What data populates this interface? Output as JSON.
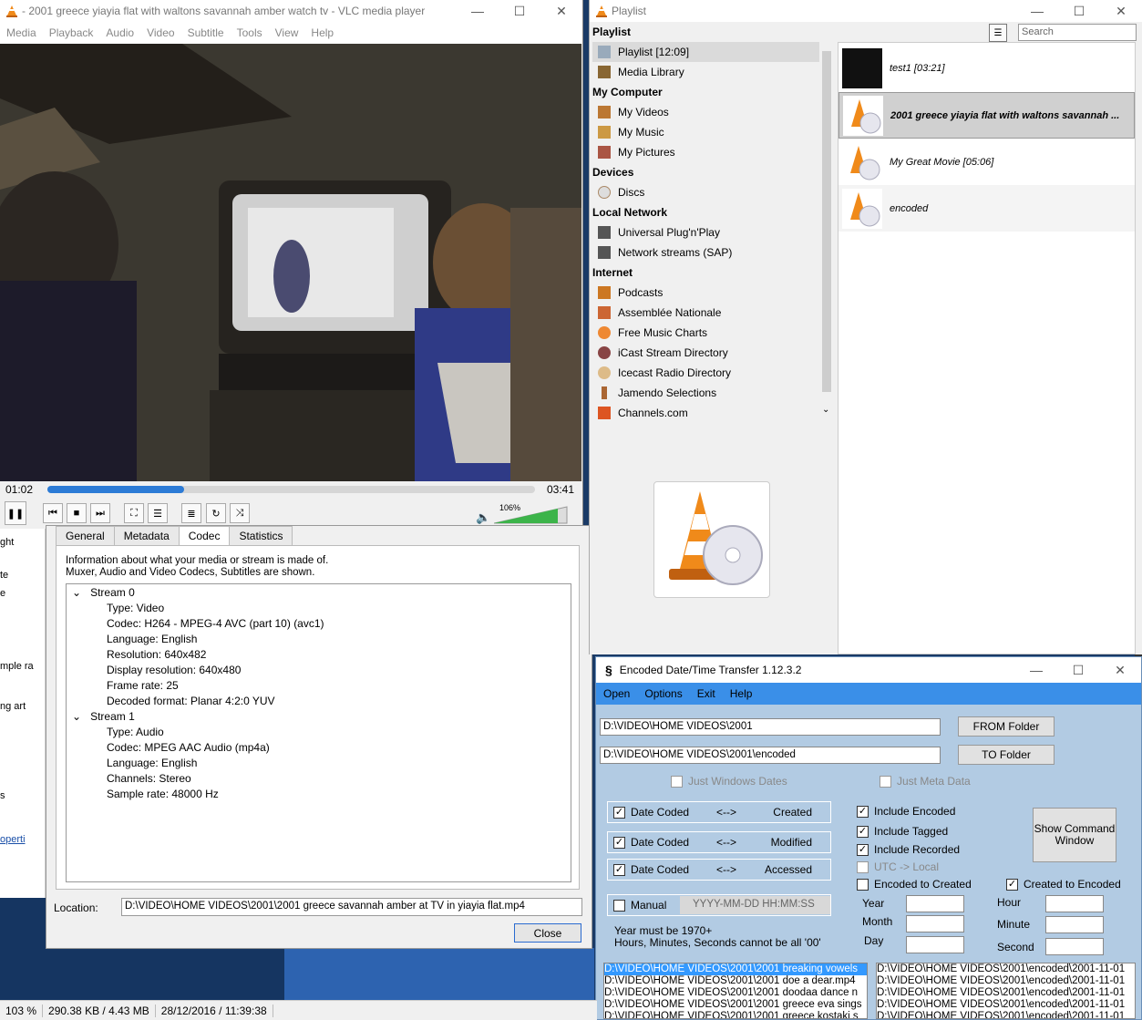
{
  "vlc": {
    "title": "- 2001 greece yiayia flat with waltons savannah amber watch tv - VLC media player",
    "menu": [
      "Media",
      "Playback",
      "Audio",
      "Video",
      "Subtitle",
      "Tools",
      "View",
      "Help"
    ],
    "elapsed": "01:02",
    "total": "03:41",
    "progress_fraction": 0.28,
    "volume": "106%"
  },
  "media_info": {
    "tabs": [
      "General",
      "Metadata",
      "Codec",
      "Statistics"
    ],
    "active_tab": "Codec",
    "desc_line1": "Information about what your media or stream is made of.",
    "desc_line2": "Muxer, Audio and Video Codecs, Subtitles are shown.",
    "streams": [
      {
        "name": "Stream 0",
        "items": [
          "Type: Video",
          "Codec: H264 - MPEG-4 AVC (part 10) (avc1)",
          "Language: English",
          "Resolution: 640x482",
          "Display resolution: 640x480",
          "Frame rate: 25",
          "Decoded format: Planar 4:2:0 YUV"
        ]
      },
      {
        "name": "Stream 1",
        "items": [
          "Type: Audio",
          "Codec: MPEG AAC Audio (mp4a)",
          "Language: English",
          "Channels: Stereo",
          "Sample rate: 48000 Hz"
        ]
      }
    ],
    "location_label": "Location:",
    "location_value": "D:\\VIDEO\\HOME VIDEOS\\2001\\2001 greece savannah amber at TV in  yiayia flat.mp4",
    "close_label": "Close"
  },
  "playlist": {
    "title": "Playlist",
    "search_placeholder": "Search",
    "sections": [
      {
        "heading": "Playlist",
        "items": [
          {
            "label": "Playlist [12:09]",
            "icon": "playlist-icon",
            "selected": true
          },
          {
            "label": "Media Library",
            "icon": "library-icon"
          }
        ]
      },
      {
        "heading": "My Computer",
        "items": [
          {
            "label": "My Videos",
            "icon": "film-icon"
          },
          {
            "label": "My Music",
            "icon": "music-icon"
          },
          {
            "label": "My Pictures",
            "icon": "picture-icon"
          }
        ]
      },
      {
        "heading": "Devices",
        "items": [
          {
            "label": "Discs",
            "icon": "disc-icon"
          }
        ]
      },
      {
        "heading": "Local Network",
        "items": [
          {
            "label": "Universal Plug'n'Play",
            "icon": "network-icon"
          },
          {
            "label": "Network streams (SAP)",
            "icon": "network-icon"
          }
        ]
      },
      {
        "heading": "Internet",
        "items": [
          {
            "label": "Podcasts",
            "icon": "podcast-icon"
          },
          {
            "label": "Assemblée Nationale",
            "icon": "assemblee-icon"
          },
          {
            "label": "Free Music Charts",
            "icon": "charts-icon"
          },
          {
            "label": "iCast Stream Directory",
            "icon": "icast-icon"
          },
          {
            "label": "Icecast Radio Directory",
            "icon": "icecast-icon"
          },
          {
            "label": "Jamendo Selections",
            "icon": "jamendo-icon"
          },
          {
            "label": "Channels.com",
            "icon": "channels-icon"
          }
        ]
      }
    ],
    "entries": [
      {
        "label": "test1 [03:21]",
        "thumb": "dark"
      },
      {
        "label": "2001 greece yiayia flat with waltons savannah ...",
        "thumb": "cone",
        "selected": true
      },
      {
        "label": "My Great Movie [05:06]",
        "thumb": "cone"
      },
      {
        "label": "encoded",
        "thumb": "cone"
      }
    ]
  },
  "enc": {
    "title": "Encoded Date/Time Transfer 1.12.3.2",
    "menu": [
      "Open",
      "Options",
      "Exit",
      "Help"
    ],
    "from_path": "D:\\VIDEO\\HOME VIDEOS\\2001",
    "to_path": "D:\\VIDEO\\HOME VIDEOS\\2001\\encoded",
    "from_btn": "FROM Folder",
    "to_btn": "TO Folder",
    "just_windows": "Just Windows Dates",
    "just_meta": "Just Meta Data",
    "rows": [
      {
        "left": "Date Coded",
        "arrow": "<-->",
        "right": "Created"
      },
      {
        "left": "Date Coded",
        "arrow": "<-->",
        "right": "Modified"
      },
      {
        "left": "Date Coded",
        "arrow": "<-->",
        "right": "Accessed"
      }
    ],
    "manual": "Manual",
    "manual_placeholder": "YYYY-MM-DD HH:MM:SS",
    "include_encoded": "Include Encoded",
    "include_tagged": "Include Tagged",
    "include_recorded": "Include Recorded",
    "utc_local": "UTC -> Local",
    "enc_to_created": "Encoded to Created",
    "created_to_enc": "Created to Encoded",
    "show_cmd": "Show Command Window",
    "year": "Year",
    "month": "Month",
    "day": "Day",
    "hour": "Hour",
    "minute": "Minute",
    "second": "Second",
    "note1": "Year must be 1970+",
    "note2": "Hours, Minutes, Seconds cannot be all '00'",
    "left_files": [
      "D:\\VIDEO\\HOME VIDEOS\\2001\\2001 breaking vowels",
      "D:\\VIDEO\\HOME VIDEOS\\2001\\2001 doe a dear.mp4",
      "D:\\VIDEO\\HOME VIDEOS\\2001\\2001 doodaa dance n",
      "D:\\VIDEO\\HOME VIDEOS\\2001\\2001 greece eva sings",
      "D:\\VIDEO\\HOME VIDEOS\\2001\\2001 greece kostaki s"
    ],
    "right_files": [
      "D:\\VIDEO\\HOME VIDEOS\\2001\\encoded\\2001-11-01",
      "D:\\VIDEO\\HOME VIDEOS\\2001\\encoded\\2001-11-01",
      "D:\\VIDEO\\HOME VIDEOS\\2001\\encoded\\2001-11-01",
      "D:\\VIDEO\\HOME VIDEOS\\2001\\encoded\\2001-11-01",
      "D:\\VIDEO\\HOME VIDEOS\\2001\\encoded\\2001-11-01"
    ]
  },
  "status": {
    "zoom": "103 %",
    "size": "290.38 KB / 4.43 MB",
    "datetime": "28/12/2016 / 11:39:38"
  },
  "bg_fragments": [
    "ght",
    "te",
    "e",
    "mple ra",
    "ng art",
    "s",
    "operti"
  ]
}
